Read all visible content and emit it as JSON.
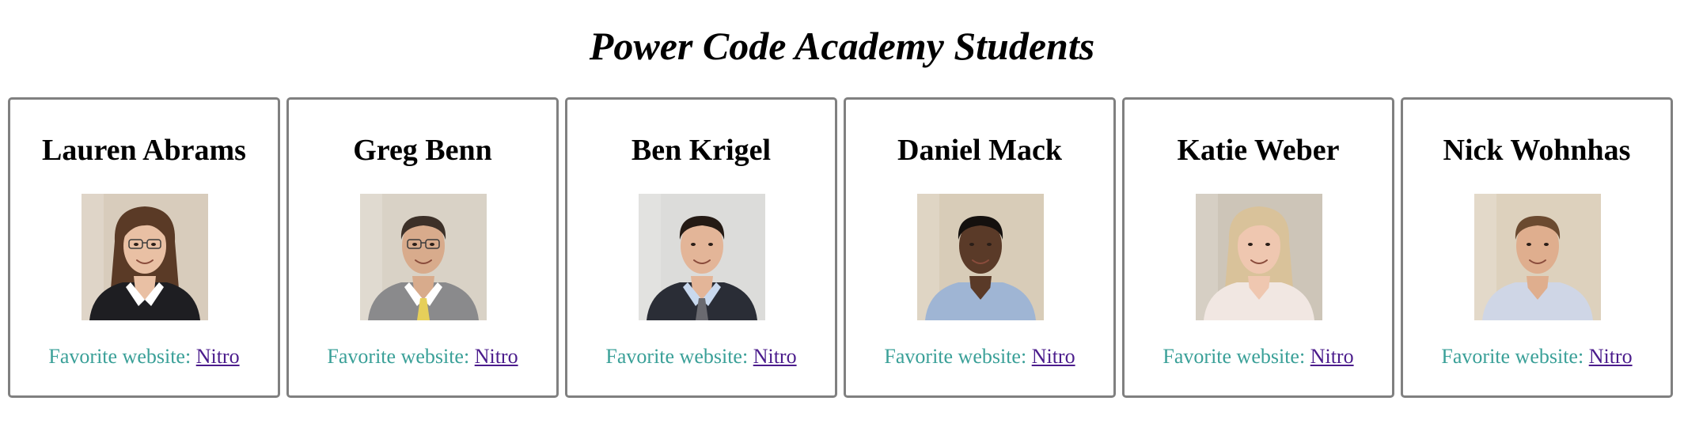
{
  "page": {
    "title": "Power Code Academy Students"
  },
  "colors": {
    "label_text": "#3aa098",
    "link_visited": "#4b1c8c",
    "card_border": "#808080"
  },
  "students": [
    {
      "name": "Lauren Abrams",
      "favorite_label": "Favorite website:",
      "favorite_link": "Nitro",
      "photo": {
        "bg": "#d8ccbc",
        "skin": "#e9c0a4",
        "hair": "#5a3a26",
        "shirt": "#1e1e22",
        "collar": "#ffffff",
        "glasses": true,
        "longHair": true
      }
    },
    {
      "name": "Greg Benn",
      "favorite_label": "Favorite website:",
      "favorite_link": "Nitro",
      "photo": {
        "bg": "#d9d2c6",
        "skin": "#d8ab8c",
        "hair": "#3c3028",
        "shirt": "#8a8a8c",
        "collar": "#ffffff",
        "tie": "#e6cf5a",
        "glasses": true,
        "longHair": false
      }
    },
    {
      "name": "Ben Krigel",
      "favorite_label": "Favorite website:",
      "favorite_link": "Nitro",
      "photo": {
        "bg": "#dcdcda",
        "skin": "#e3b598",
        "hair": "#241a14",
        "shirt": "#2a2d36",
        "collar": "#c9d9ee",
        "tie": "#6a6a70",
        "glasses": false,
        "longHair": false
      }
    },
    {
      "name": "Daniel Mack",
      "favorite_label": "Favorite website:",
      "favorite_link": "Nitro",
      "photo": {
        "bg": "#d8ccb8",
        "skin": "#5a3a28",
        "hair": "#14100e",
        "shirt": "#9fb5d4",
        "collar": "#9fb5d4",
        "glasses": false,
        "longHair": false
      }
    },
    {
      "name": "Katie Weber",
      "favorite_label": "Favorite website:",
      "favorite_link": "Nitro",
      "photo": {
        "bg": "#cdc5b8",
        "skin": "#efc7b0",
        "hair": "#d9c29a",
        "shirt": "#f1e7e2",
        "collar": "#f1e7e2",
        "glasses": false,
        "longHair": true
      }
    },
    {
      "name": "Nick Wohnhas",
      "favorite_label": "Favorite website:",
      "favorite_link": "Nitro",
      "photo": {
        "bg": "#ddd1bd",
        "skin": "#dfae8e",
        "hair": "#6b4a30",
        "shirt": "#cfd6e6",
        "collar": "#cfd6e6",
        "glasses": false,
        "longHair": false
      }
    }
  ]
}
